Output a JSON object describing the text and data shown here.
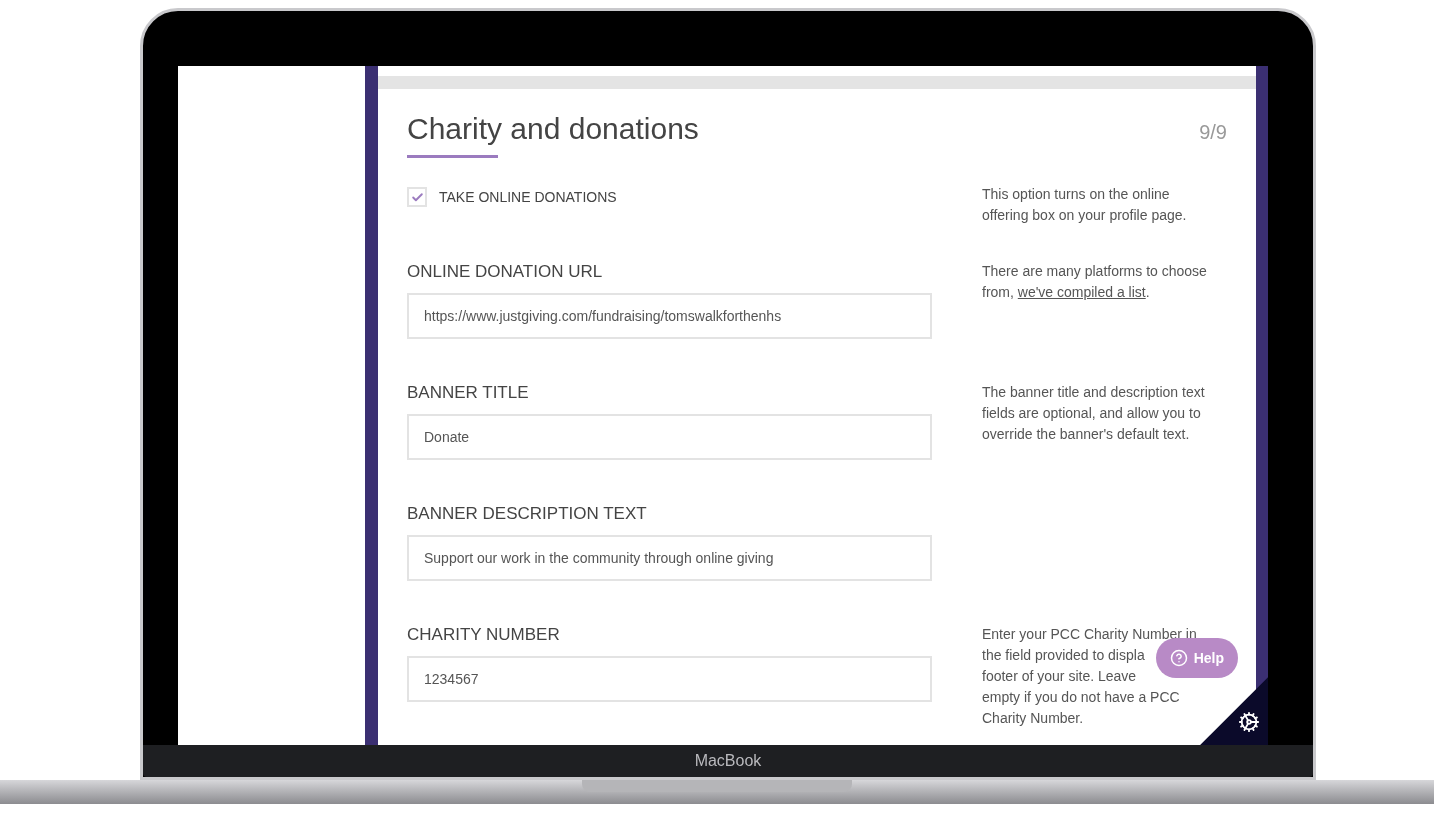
{
  "section": {
    "title": "Charity and donations",
    "step": "9/9"
  },
  "rows": [
    {
      "kind": "checkbox",
      "label": "TAKE ONLINE DONATIONS",
      "checked": true,
      "note": {
        "text": "This option turns on the online offering box on your profile page."
      }
    },
    {
      "kind": "field",
      "label": "ONLINE DONATION URL",
      "value": "https://www.justgiving.com/fundraising/tomswalkforthenhs",
      "note": {
        "text": "There are many platforms to choose from,",
        "link": "we've compiled a list",
        "after": "."
      }
    },
    {
      "kind": "field",
      "label": "BANNER TITLE",
      "value": "Donate",
      "note": {
        "text": "The banner title and description text fields are optional, and allow you to override the banner's default text."
      }
    },
    {
      "kind": "field",
      "label": "BANNER DESCRIPTION TEXT",
      "value": "Support our work in the community through online giving"
    },
    {
      "kind": "field",
      "label": "CHARITY NUMBER",
      "value": "1234567",
      "note": {
        "lines": [
          "Enter your PCC Charity Number in",
          "the field provided to displa",
          "footer of your site. Leave",
          "empty if you do not have a PCC",
          "Charity Number."
        ]
      }
    }
  ],
  "help_button": {
    "label": "Help"
  },
  "laptop": {
    "brand": "MacBook"
  }
}
